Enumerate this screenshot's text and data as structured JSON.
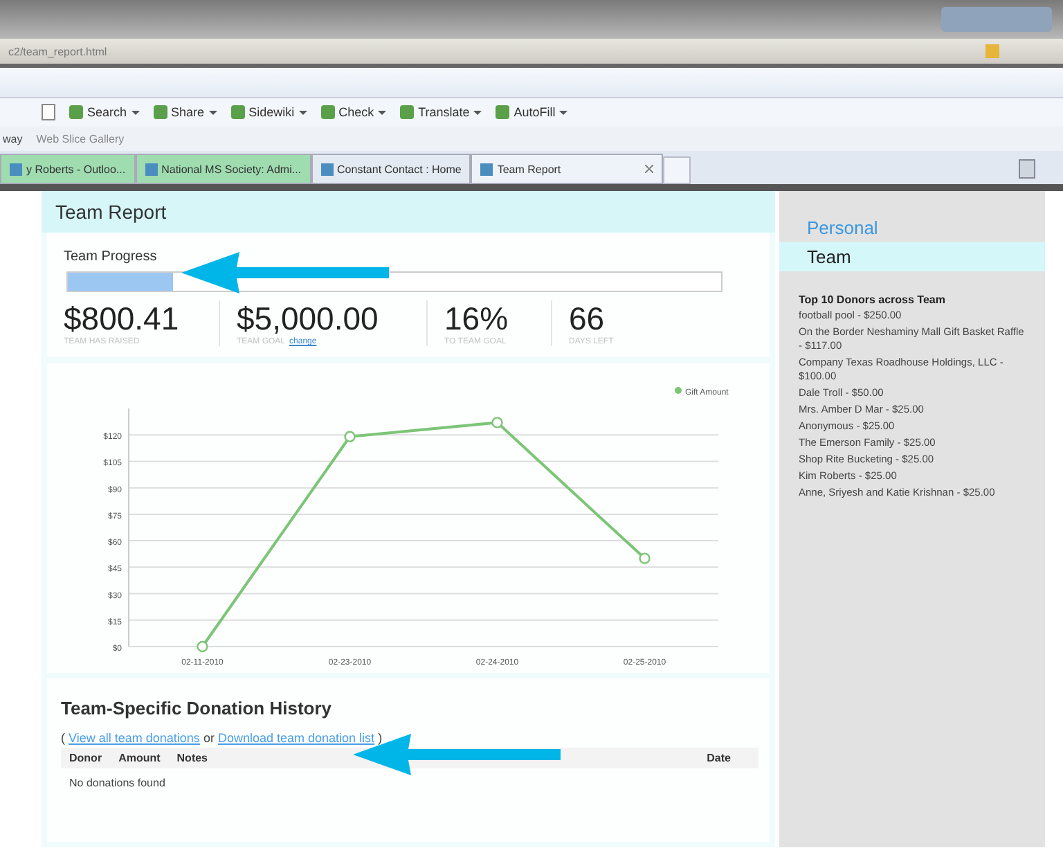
{
  "browser": {
    "address": "c2/team_report.html",
    "toolbar": [
      {
        "label": "Search"
      },
      {
        "label": "Share"
      },
      {
        "label": "Sidewiki"
      },
      {
        "label": "Check"
      },
      {
        "label": "Translate"
      },
      {
        "label": "AutoFill"
      }
    ],
    "favorites": [
      {
        "label": "way"
      },
      {
        "label": "Web Slice Gallery"
      }
    ],
    "tabs": [
      {
        "label": "y Roberts - Outloo...",
        "selected": false
      },
      {
        "label": "National MS Society: Admi...",
        "selected": false
      },
      {
        "label": "Constant Contact : Home",
        "selected": false
      },
      {
        "label": "Team Report",
        "selected": true
      }
    ]
  },
  "page": {
    "title": "Team Report",
    "progress": {
      "title": "Team Progress",
      "level": 0.16,
      "stats": [
        {
          "value": "$800.41",
          "label": "TEAM HAS RAISED"
        },
        {
          "value": "$5,000.00",
          "label": "TEAM GOAL",
          "link": "change"
        },
        {
          "value": "16%",
          "label": "TO TEAM GOAL"
        },
        {
          "value": "66",
          "label": "DAYS LEFT"
        }
      ]
    },
    "chart_data": {
      "type": "line",
      "categories": [
        "02-11-2010",
        "02-23-2010",
        "02-24-2010",
        "02-25-2010"
      ],
      "series": [
        {
          "name": "Gift Amount",
          "color": "#7cc576",
          "marker": "circle",
          "values": [
            0,
            119,
            127,
            50
          ]
        }
      ],
      "ylim": [
        0,
        135
      ],
      "grid": true,
      "yticks": [
        {
          "value": 0,
          "label": "$0"
        },
        {
          "value": 15,
          "label": "$15"
        },
        {
          "value": 30,
          "label": "$30"
        },
        {
          "value": 45,
          "label": "$45"
        },
        {
          "value": 60,
          "label": "$60"
        },
        {
          "value": 75,
          "label": "$75"
        },
        {
          "value": 90,
          "label": "$90"
        },
        {
          "value": 105,
          "label": "$105"
        },
        {
          "value": 120,
          "label": "$120"
        }
      ]
    },
    "history": {
      "title": "Team-Specific Donation History",
      "links": [
        {
          "kind": "text",
          "text": "("
        },
        {
          "kind": "link",
          "text": "View all team donations"
        },
        {
          "kind": "text",
          "text": "or"
        },
        {
          "kind": "link",
          "text": "Download team donation list"
        },
        {
          "kind": "text",
          "text": ")"
        }
      ],
      "columns": [
        "Donor",
        "Amount",
        "Notes",
        "Date"
      ],
      "empty": "No donations found"
    }
  },
  "sidebar": {
    "items": [
      {
        "label": "Personal",
        "selected": false
      },
      {
        "label": "Team",
        "selected": true
      }
    ],
    "donors_title": "Top 10 Donors across Team",
    "donors": [
      "football pool - $250.00",
      "On the Border Neshaminy Mall Gift Basket Raffle - $117.00",
      "Company Texas Roadhouse Holdings, LLC - $100.00",
      "Dale Troll - $50.00",
      "Mrs. Amber D Mar - $25.00",
      "Anonymous - $25.00",
      "The Emerson Family - $25.00",
      "Shop Rite Bucketing - $25.00",
      "Kim Roberts - $25.00",
      "Anne, Sriyesh and Katie Krishnan - $25.00"
    ]
  }
}
